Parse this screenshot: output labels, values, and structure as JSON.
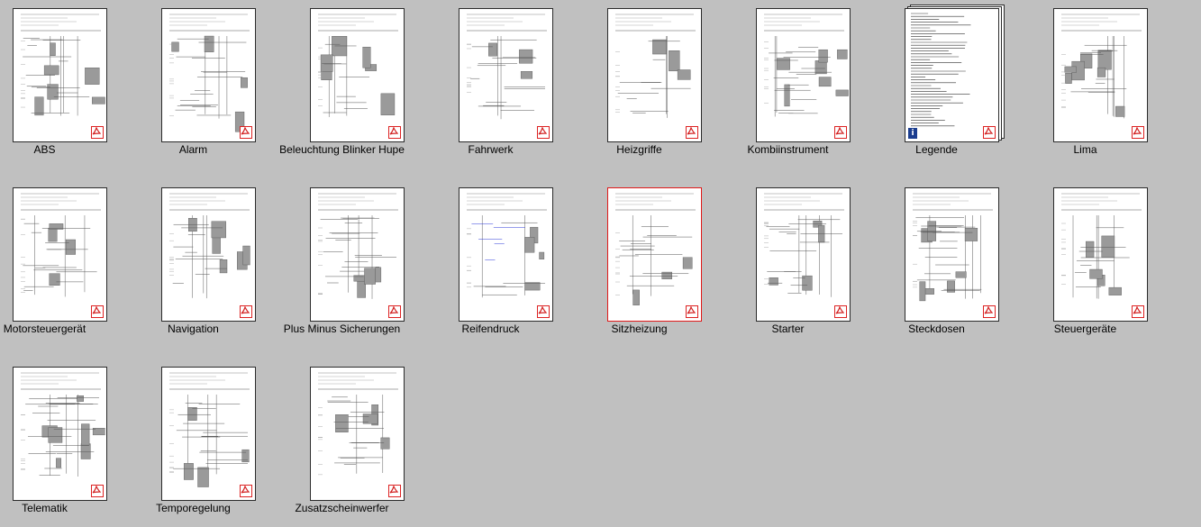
{
  "files": [
    {
      "name": "ABS",
      "kind": "schematic",
      "selected": false
    },
    {
      "name": "Alarm",
      "kind": "schematic",
      "selected": false
    },
    {
      "name": "Beleuchtung Blinker Hupe",
      "kind": "schematic",
      "selected": false
    },
    {
      "name": "Fahrwerk",
      "kind": "schematic",
      "selected": false
    },
    {
      "name": "Heizgriffe",
      "kind": "schematic-color",
      "selected": false
    },
    {
      "name": "Kombiinstrument",
      "kind": "schematic",
      "selected": false
    },
    {
      "name": "Legende",
      "kind": "text-doc",
      "selected": false
    },
    {
      "name": "Lima",
      "kind": "schematic",
      "selected": false
    },
    {
      "name": "Motorsteuergerät",
      "kind": "schematic",
      "selected": false
    },
    {
      "name": "Navigation",
      "kind": "schematic",
      "selected": false
    },
    {
      "name": "Plus Minus  Sicherungen",
      "kind": "schematic",
      "selected": false
    },
    {
      "name": "Reifendruck",
      "kind": "schematic-color",
      "selected": false
    },
    {
      "name": "Sitzheizung",
      "kind": "schematic",
      "selected": true
    },
    {
      "name": "Starter",
      "kind": "schematic",
      "selected": false
    },
    {
      "name": "Steckdosen",
      "kind": "schematic",
      "selected": false
    },
    {
      "name": "Steuergeräte",
      "kind": "schematic",
      "selected": false
    },
    {
      "name": "Telematik",
      "kind": "schematic",
      "selected": false
    },
    {
      "name": "Temporegelung",
      "kind": "schematic",
      "selected": false
    },
    {
      "name": "Zusatzscheinwerfer",
      "kind": "schematic",
      "selected": false
    }
  ],
  "icons": {
    "pdf": "pdf-file-icon",
    "info": "info-overlay-icon"
  },
  "colors": {
    "background": "#c0c0c0",
    "selection_border": "#e01919",
    "pdf_red": "#d22222",
    "wire_blue": "#2d3ad8",
    "component_gray": "#9a9a9a"
  }
}
